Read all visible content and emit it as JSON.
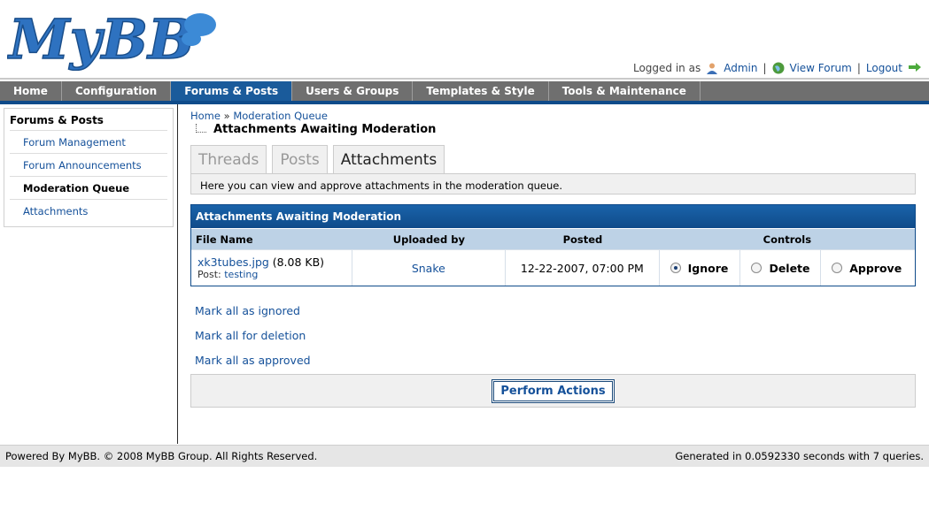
{
  "header": {
    "logo_text": "MyBB",
    "logged_in_label": "Logged in as",
    "user_name": "Admin",
    "view_forum": "View Forum",
    "logout": "Logout",
    "separator": "|"
  },
  "menu": {
    "tabs": [
      {
        "label": "Home"
      },
      {
        "label": "Configuration"
      },
      {
        "label": "Forums & Posts"
      },
      {
        "label": "Users & Groups"
      },
      {
        "label": "Templates & Style"
      },
      {
        "label": "Tools & Maintenance"
      }
    ],
    "active_index": 2,
    "colors": {
      "bar": "#6f6f6f",
      "active": "#1a5b9b",
      "underline": "#0f4b8a"
    }
  },
  "sidebar": {
    "title": "Forums & Posts",
    "items": [
      {
        "label": "Forum Management"
      },
      {
        "label": "Forum Announcements"
      },
      {
        "label": "Moderation Queue"
      },
      {
        "label": "Attachments"
      }
    ],
    "current_index": 2
  },
  "breadcrumb": {
    "home": "Home",
    "separator": "»",
    "current": "Moderation Queue"
  },
  "page_title": "Attachments Awaiting Moderation",
  "subtabs": {
    "items": [
      {
        "label": "Threads"
      },
      {
        "label": "Posts"
      },
      {
        "label": "Attachments"
      }
    ],
    "active_index": 2,
    "description": "Here you can view and approve attachments in the moderation queue."
  },
  "table": {
    "title": "Attachments Awaiting Moderation",
    "columns": [
      "File Name",
      "Uploaded by",
      "Posted",
      "Controls"
    ],
    "rows": [
      {
        "file_name": "xk3tubes.jpg",
        "file_size": "(8.08 KB)",
        "post_label": "Post:",
        "post_title": "testing",
        "uploaded_by": "Snake",
        "posted": "12-22-2007, 07:00 PM",
        "controls": [
          "Ignore",
          "Delete",
          "Approve"
        ],
        "selected_control": "Ignore"
      }
    ]
  },
  "mark_links": [
    "Mark all as ignored",
    "Mark all for deletion",
    "Mark all as approved"
  ],
  "perform_button": "Perform Actions",
  "footer": {
    "left": "Powered By MyBB. © 2008 MyBB Group. All Rights Reserved.",
    "right": "Generated in 0.0592330 seconds with 7 queries."
  }
}
